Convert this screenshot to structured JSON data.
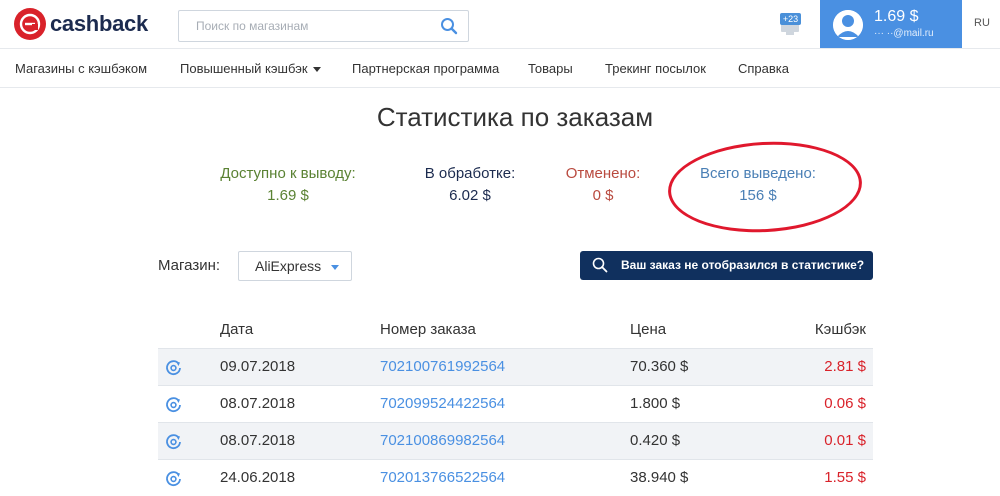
{
  "header": {
    "logo_text": "cashback",
    "search_placeholder": "Поиск по магазинам",
    "notifications_badge": "+23",
    "balance": "1.69 $",
    "email": "··· ··@mail.ru",
    "language": "RU"
  },
  "nav": {
    "items": [
      {
        "label": "Магазины с кэшбэком"
      },
      {
        "label": "Повышенный кэшбэк"
      },
      {
        "label": "Партнерская программа"
      },
      {
        "label": "Товары"
      },
      {
        "label": "Трекинг посылок"
      },
      {
        "label": "Справка"
      }
    ]
  },
  "page_title": "Статистика по заказам",
  "stats": {
    "available": {
      "label": "Доступно к выводу:",
      "value": "1.69 $"
    },
    "processing": {
      "label": "В обработке:",
      "value": "6.02 $"
    },
    "cancelled": {
      "label": "Отменено:",
      "value": "0 $"
    },
    "withdrawn": {
      "label": "Всего выведено:",
      "value": "156 $"
    }
  },
  "filter": {
    "label": "Магазин:",
    "selected": "AliExpress",
    "missing_order_button": "Ваш заказ не отобразился в статистике?"
  },
  "table": {
    "headers": {
      "date": "Дата",
      "order": "Номер заказа",
      "price": "Цена",
      "cashback": "Кэшбэк"
    },
    "rows": [
      {
        "date": "09.07.2018",
        "order": "702100761992564",
        "price": "70.360 $",
        "cashback": "2.81 $"
      },
      {
        "date": "08.07.2018",
        "order": "702099524422564",
        "price": "1.800 $",
        "cashback": "0.06 $"
      },
      {
        "date": "08.07.2018",
        "order": "702100869982564",
        "price": "0.420 $",
        "cashback": "0.01 $"
      },
      {
        "date": "24.06.2018",
        "order": "702013766522564",
        "price": "38.940 $",
        "cashback": "1.55 $"
      }
    ]
  },
  "colors": {
    "brand_red": "#d9222a",
    "brand_navy": "#1c2b4f",
    "accent_blue": "#4a90e2",
    "available_green": "#5a8233",
    "cancelled_red": "#b94a3f",
    "withdrawn_blue": "#4a7fb5",
    "highlight_ring": "#e0182d"
  },
  "icons": {
    "logo": "e-logo-icon",
    "search": "search-icon",
    "notifications": "notification-icon",
    "avatar": "user-avatar-icon",
    "row_status": "refresh-status-icon"
  }
}
